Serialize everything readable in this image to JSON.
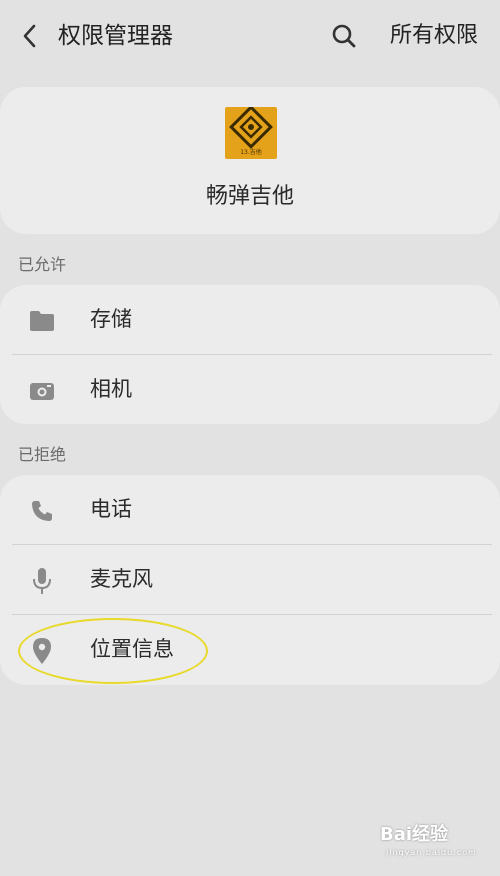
{
  "header": {
    "title": "权限管理器",
    "all_permissions": "所有权限"
  },
  "app": {
    "name": "畅弹吉他",
    "logo_caption": "13.吉他"
  },
  "sections": {
    "allowed_label": "已允许",
    "denied_label": "已拒绝"
  },
  "allowed": [
    {
      "label": "存储",
      "icon": "folder-icon"
    },
    {
      "label": "相机",
      "icon": "camera-icon"
    }
  ],
  "denied": [
    {
      "label": "电话",
      "icon": "phone-icon"
    },
    {
      "label": "麦克风",
      "icon": "microphone-icon"
    },
    {
      "label": "位置信息",
      "icon": "location-pin-icon"
    }
  ],
  "colors": {
    "background": "#e2e2e2",
    "card": "#ececec",
    "logo": "#e4a21a",
    "highlight": "#e8d92a"
  },
  "watermark": "Bai经验",
  "watermark_sub": "jingyan.baidu.com"
}
